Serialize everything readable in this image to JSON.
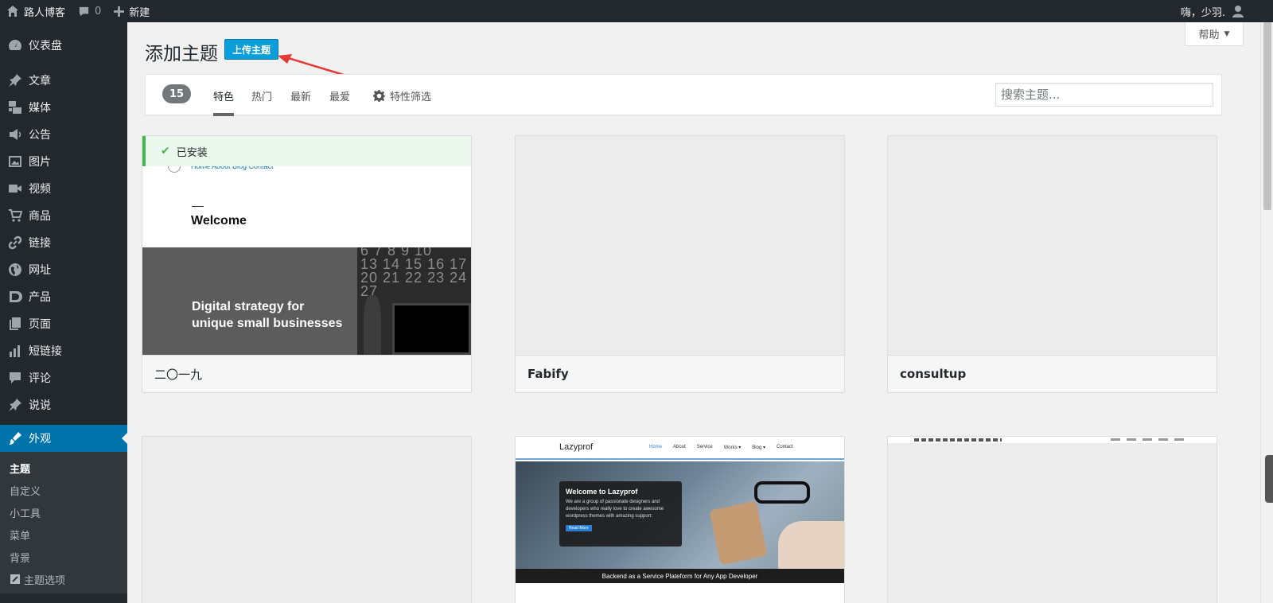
{
  "adminbar": {
    "site_name": "路人博客",
    "comments_count": "0",
    "new_label": "新建",
    "greeting": "嗨，少羽."
  },
  "sidebar": {
    "items": [
      {
        "label": "仪表盘",
        "icon": "dashboard-icon"
      },
      {
        "label": "文章",
        "icon": "pin-icon"
      },
      {
        "label": "媒体",
        "icon": "media-icon"
      },
      {
        "label": "公告",
        "icon": "megaphone-icon"
      },
      {
        "label": "图片",
        "icon": "image-icon"
      },
      {
        "label": "视频",
        "icon": "video-icon"
      },
      {
        "label": "商品",
        "icon": "cart-icon"
      },
      {
        "label": "链接",
        "icon": "link-icon"
      },
      {
        "label": "网址",
        "icon": "globe-icon"
      },
      {
        "label": "产品",
        "icon": "product-icon"
      },
      {
        "label": "页面",
        "icon": "pages-icon"
      },
      {
        "label": "短链接",
        "icon": "chart-icon"
      },
      {
        "label": "评论",
        "icon": "comment-icon"
      },
      {
        "label": "说说",
        "icon": "pin-icon"
      }
    ],
    "current": {
      "label": "外观",
      "icon": "appearance-icon"
    },
    "submenu": [
      "主题",
      "自定义",
      "小工具",
      "菜单",
      "背景",
      "主题选项"
    ]
  },
  "help_label": "帮助",
  "page": {
    "title": "添加主题",
    "upload_button": "上传主题"
  },
  "filter": {
    "count": "15",
    "tabs": [
      "特色",
      "热门",
      "最新",
      "最爱"
    ],
    "feature_filter": "特性筛选",
    "search_placeholder": "搜索主题..."
  },
  "themes": [
    {
      "name": "二〇一九",
      "installed_label": "已安装"
    },
    {
      "name": "Fabify"
    },
    {
      "name": "consultup"
    },
    {
      "name": ""
    },
    {
      "name": ""
    },
    {
      "name": ""
    }
  ],
  "preview_2019": {
    "nav": "Home  About  Blog  Contact",
    "welcome": "Welcome",
    "headline_1": "Digital strategy for",
    "headline_2": "unique small businesses",
    "calendar": [
      "6 7 8 9 10",
      "13 14 15 16 17",
      "20 21 22 23 24",
      "27"
    ]
  },
  "preview_lazyprof": {
    "logo": "Lazyprof",
    "nav": [
      "Home",
      "About",
      "Service",
      "Works ▾",
      "Blog ▾",
      "Contact"
    ],
    "hero_title": "Welcome to Lazyprof",
    "hero_text": "We are a group of passionate designers and developers who really love to create awesome wordpress themes with amazing support.",
    "hero_button": "Read More",
    "footer_strip": "Backend as a Service Plateform for Any App Developer"
  },
  "colors": {
    "admin_dark": "#23282d",
    "accent": "#0073aa",
    "upload_button": "#0a9fdb",
    "installed_green": "#46b450"
  }
}
